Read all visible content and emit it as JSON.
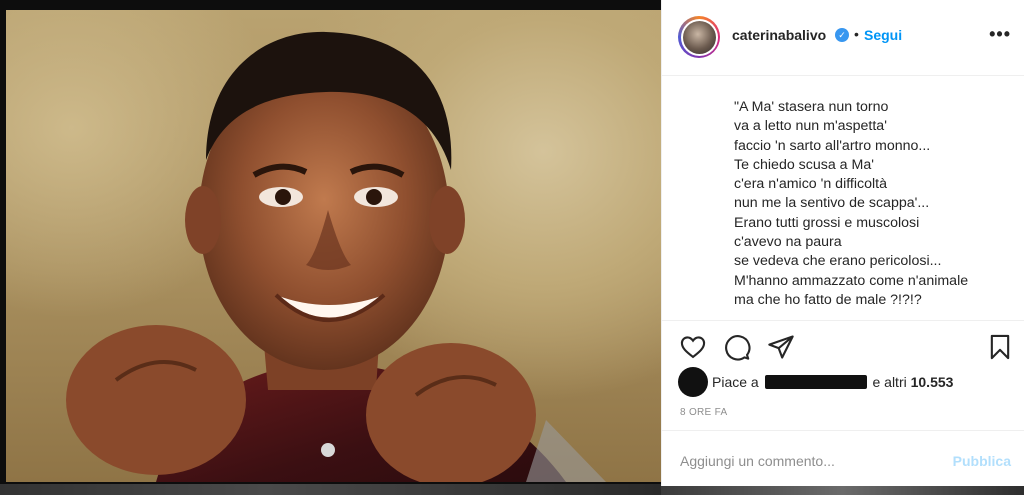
{
  "post": {
    "image_alt": "portrait photo",
    "username": "caterinabalivo",
    "verified": true,
    "separator": "•",
    "follow_label": "Segui",
    "more_label": "•••"
  },
  "caption": {
    "lines": [
      "\"A Ma' stasera nun torno",
      "va a letto nun m'aspetta'",
      "faccio 'n sarto all'artro monno...",
      "Te chiedo scusa a Ma'",
      "c'era n'amico 'n difficoltà",
      "nun me la sentivo de scappa'...",
      "Erano tutti grossi e muscolosi",
      "c'avevo na paura",
      "se vedeva che erano pericolosi...",
      "M'hanno ammazzato come n'animale",
      "ma che ho fatto de male ?!?!?"
    ]
  },
  "actions": {
    "like_icon": "heart-icon",
    "comment_icon": "comment-icon",
    "share_icon": "share-icon",
    "save_icon": "bookmark-icon"
  },
  "likes": {
    "prefix": "Piace a",
    "suffix": "e altri",
    "count": "10.553"
  },
  "timestamp": "8 ORE FA",
  "comment": {
    "placeholder": "Aggiungi un commento...",
    "publish_label": "Pubblica"
  },
  "colors": {
    "link_blue": "#0095f6",
    "verified_blue": "#3897f0",
    "publish_disabled": "#b2dffc",
    "muted_gray": "#8e8e8e"
  }
}
